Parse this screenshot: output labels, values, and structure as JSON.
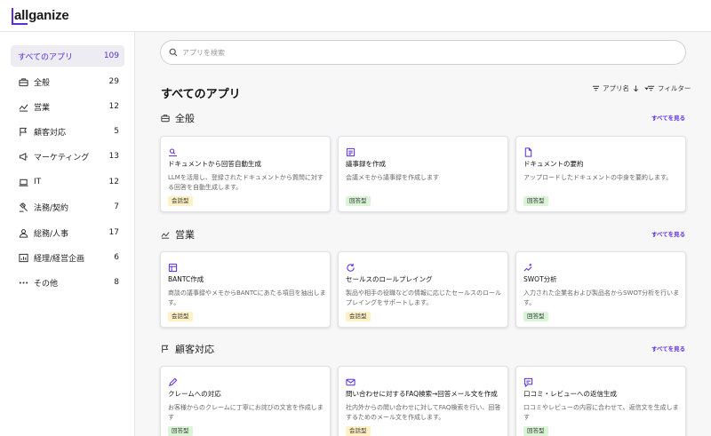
{
  "brand": {
    "name": "allganize"
  },
  "colors": {
    "accent": "#5b2be0",
    "badge_kaiwa": "#fff1c4",
    "badge_kaito": "#d9f5d6"
  },
  "sidebar": {
    "items": [
      {
        "label": "すべてのアプリ",
        "count": "109",
        "icon": "none",
        "active": true
      },
      {
        "label": "全般",
        "count": "29",
        "icon": "briefcase-icon"
      },
      {
        "label": "営業",
        "count": "12",
        "icon": "trend-icon"
      },
      {
        "label": "顧客対応",
        "count": "5",
        "icon": "flag-icon"
      },
      {
        "label": "マーケティング",
        "count": "13",
        "icon": "megaphone-icon"
      },
      {
        "label": "IT",
        "count": "12",
        "icon": "laptop-icon"
      },
      {
        "label": "法務/契約",
        "count": "7",
        "icon": "gavel-icon"
      },
      {
        "label": "総務/人事",
        "count": "17",
        "icon": "person-icon"
      },
      {
        "label": "経理/経営企画",
        "count": "6",
        "icon": "chart-icon"
      },
      {
        "label": "その他",
        "count": "8",
        "icon": "dots-icon"
      }
    ]
  },
  "search": {
    "placeholder": "アプリを検索"
  },
  "main": {
    "title": "すべてのアプリ",
    "sort_label": "アプリ名",
    "filter_label": "フィルター",
    "see_all_label": "すべてを見る",
    "sections": [
      {
        "title": "全般",
        "icon": "briefcase-icon",
        "cards": [
          {
            "title": "ドキュメントから回答自動生成",
            "desc": "LLMを活用し、登録されたドキュメントから質問に対する回答を自動生成します。",
            "badge": "会話型",
            "icon": "doc-search-icon"
          },
          {
            "title": "議事録を作成",
            "desc": "会議メモから議事録を作成します",
            "badge": "回答型",
            "icon": "notes-icon"
          },
          {
            "title": "ドキュメントの要約",
            "desc": "アップロードしたドキュメントの中身を要約します。",
            "badge": "回答型",
            "icon": "file-icon"
          }
        ]
      },
      {
        "title": "営業",
        "icon": "trend-icon",
        "cards": [
          {
            "title": "BANTC作成",
            "desc": "商談の議事録やメモからBANTCにあたる項目を抽出します。",
            "badge": "会話型",
            "icon": "layout-icon"
          },
          {
            "title": "セールスのロールプレイング",
            "desc": "製品や相手の役職などの情報に応じたセールスのロールプレイングをサポートします。",
            "badge": "会話型",
            "icon": "refresh-icon"
          },
          {
            "title": "SWOT分析",
            "desc": "入力された企業名および製品名からSWOT分析を行います。",
            "badge": "回答型",
            "icon": "sparkle-chart-icon"
          }
        ]
      },
      {
        "title": "顧客対応",
        "icon": "flag-icon",
        "cards": [
          {
            "title": "クレームへの対応",
            "desc": "お客様からのクレームに丁寧にお詫びの文言を作成します",
            "badge": "回答型",
            "icon": "pencil-icon"
          },
          {
            "title": "問い合わせに対するFAQ検索→回答メール文を作成",
            "desc": "社内外からの問い合わせに対してFAQ検索を行い、回答するためのメール文を作成します。",
            "badge": "会話型",
            "icon": "mail-icon"
          },
          {
            "title": "口コミ・レビューへの返信生成",
            "desc": "口コミやレビューの内容に合わせて、返信文を生成します",
            "badge": "回答型",
            "icon": "chat-icon"
          }
        ]
      }
    ]
  }
}
